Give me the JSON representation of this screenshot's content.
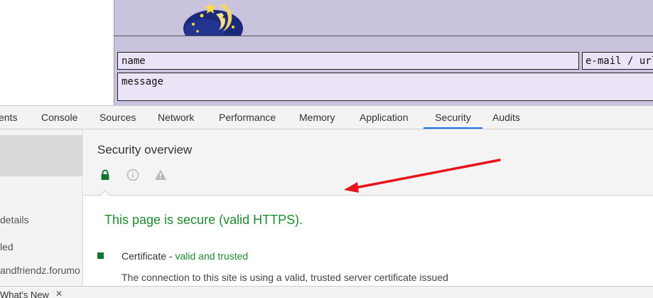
{
  "site": {
    "name_label": "name",
    "email_label": "e-mail / url",
    "message_label": "message"
  },
  "devtools": {
    "tabs": [
      {
        "label": "ents"
      },
      {
        "label": "Console"
      },
      {
        "label": "Sources"
      },
      {
        "label": "Network"
      },
      {
        "label": "Performance"
      },
      {
        "label": "Memory"
      },
      {
        "label": "Application"
      },
      {
        "label": "Security"
      },
      {
        "label": "Audits"
      }
    ],
    "active_tab": "Security",
    "sidebar": {
      "items": [
        {
          "label": "details"
        },
        {
          "label": "led"
        },
        {
          "label": "andfriendz.forumo"
        }
      ]
    },
    "overview": {
      "title": "Security overview",
      "icons": [
        "lock-icon",
        "info-icon",
        "warning-icon"
      ],
      "secure_message": "This page is secure (valid HTTPS).",
      "certificate": {
        "label": "Certificate - ",
        "status": "valid and trusted",
        "description": "The connection to this site is using a valid, trusted server certificate issued"
      }
    },
    "drawer": {
      "tab_label": "What's New",
      "close_glyph": "✕"
    }
  },
  "colors": {
    "secure_green": "#1e8a2f",
    "tab_active_underline": "#1a73e8",
    "annotation_arrow": "#e8141b",
    "site_background": "#cac3dd",
    "field_background": "#ebe4f6"
  }
}
